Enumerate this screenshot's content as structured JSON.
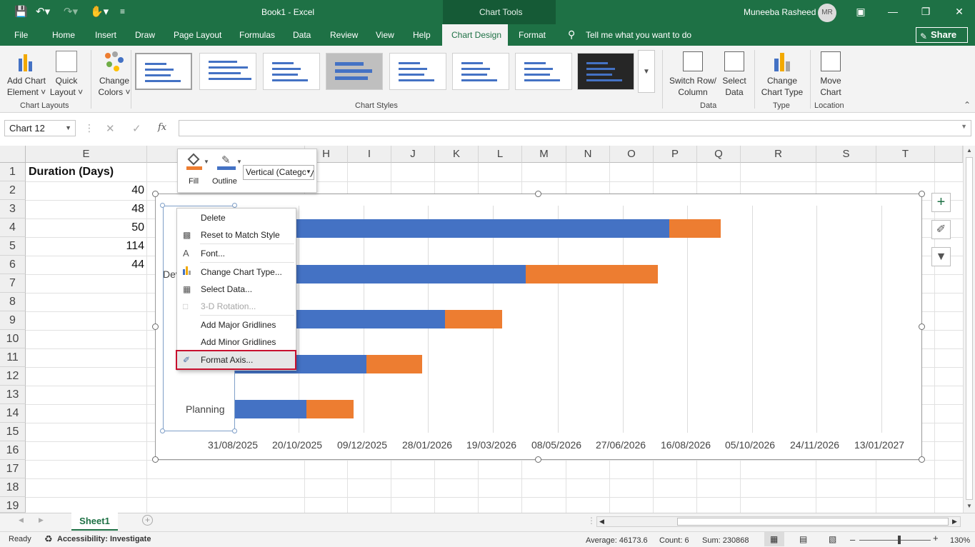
{
  "titlebar": {
    "title": "Book1  -  Excel",
    "context_tab": "Chart Tools",
    "user": "Muneeba Rasheed",
    "avatar_initials": "MR"
  },
  "menu": {
    "tabs": [
      "File",
      "Home",
      "Insert",
      "Draw",
      "Page Layout",
      "Formulas",
      "Data",
      "Review",
      "View",
      "Help",
      "Chart Design",
      "Format"
    ],
    "tell_me": "Tell me what you want to do",
    "share": "Share"
  },
  "ribbon": {
    "add_chart_element": [
      "Add Chart",
      "Element"
    ],
    "quick_layout": [
      "Quick",
      "Layout"
    ],
    "change_colors": [
      "Change",
      "Colors"
    ],
    "switch_row_col": [
      "Switch Row/",
      "Column"
    ],
    "select_data": [
      "Select",
      "Data"
    ],
    "change_chart_type": [
      "Change",
      "Chart Type"
    ],
    "move_chart": [
      "Move",
      "Chart"
    ],
    "groups": {
      "chart_layouts": "Chart Layouts",
      "chart_styles": "Chart Styles",
      "data": "Data",
      "type": "Type",
      "location": "Location"
    }
  },
  "formula_bar": {
    "name_box": "Chart 12",
    "fx": "fx",
    "value": ""
  },
  "grid": {
    "columns": [
      "E",
      "H",
      "I",
      "J",
      "K",
      "L",
      "M",
      "N",
      "O",
      "P",
      "Q",
      "R",
      "S",
      "T"
    ],
    "rows": [
      "1",
      "2",
      "3",
      "4",
      "5",
      "6",
      "7",
      "8",
      "9",
      "10",
      "11",
      "12",
      "13",
      "14",
      "15",
      "16",
      "17",
      "18",
      "19"
    ],
    "e_header": "Duration (Days)",
    "e_values": [
      "40",
      "48",
      "50",
      "114",
      "44"
    ]
  },
  "mini_toolbar": {
    "fill": "Fill",
    "outline": "Outline",
    "element_select": "Vertical (Category) Axis"
  },
  "context_menu": {
    "items": [
      {
        "label": "Delete",
        "icon": "",
        "disabled": false
      },
      {
        "label": "Reset to Match Style",
        "icon": "reset-style-icon",
        "disabled": false
      },
      {
        "label": "Font...",
        "icon": "font-icon",
        "disabled": false
      },
      {
        "label": "Change Chart Type...",
        "icon": "chart-type-icon",
        "disabled": false
      },
      {
        "label": "Select Data...",
        "icon": "select-data-icon",
        "disabled": false
      },
      {
        "label": "3-D Rotation...",
        "icon": "rotation-icon",
        "disabled": true
      },
      {
        "label": "Add Major Gridlines",
        "icon": "",
        "disabled": false
      },
      {
        "label": "Add Minor Gridlines",
        "icon": "",
        "disabled": false
      },
      {
        "label": "Format Axis...",
        "icon": "format-axis-icon",
        "disabled": false
      }
    ],
    "highlighted": "Format Axis..."
  },
  "chart_data": {
    "type": "bar",
    "orientation": "horizontal",
    "stacked": true,
    "categories_visible": [
      "Planning",
      "Dev"
    ],
    "x_tick_labels": [
      "31/08/2025",
      "20/10/2025",
      "09/12/2025",
      "28/01/2026",
      "19/03/2026",
      "08/05/2026",
      "27/06/2026",
      "16/08/2026",
      "05/10/2026",
      "24/11/2026",
      "13/01/2027"
    ],
    "xlim": [
      "31/08/2025",
      "13/01/2027"
    ],
    "series": [
      {
        "name": "",
        "color": "#4472c4",
        "values_days": [
          336,
          225,
          163,
          102,
          56
        ]
      },
      {
        "name": "",
        "color": "#ed7d31",
        "values_days": [
          40,
          102,
          44,
          43,
          36
        ]
      }
    ],
    "grid": true,
    "legend": "none"
  },
  "colors": {
    "excel_green": "#1e7145",
    "series1": "#4472c4",
    "series2": "#ed7d31",
    "highlight_border": "#c8102e"
  },
  "sheets": {
    "active": "Sheet1"
  },
  "status": {
    "ready": "Ready",
    "accessibility": "Accessibility: Investigate",
    "average": "Average: 46173.6",
    "count": "Count: 6",
    "sum": "Sum: 230868",
    "zoom": "130%"
  }
}
